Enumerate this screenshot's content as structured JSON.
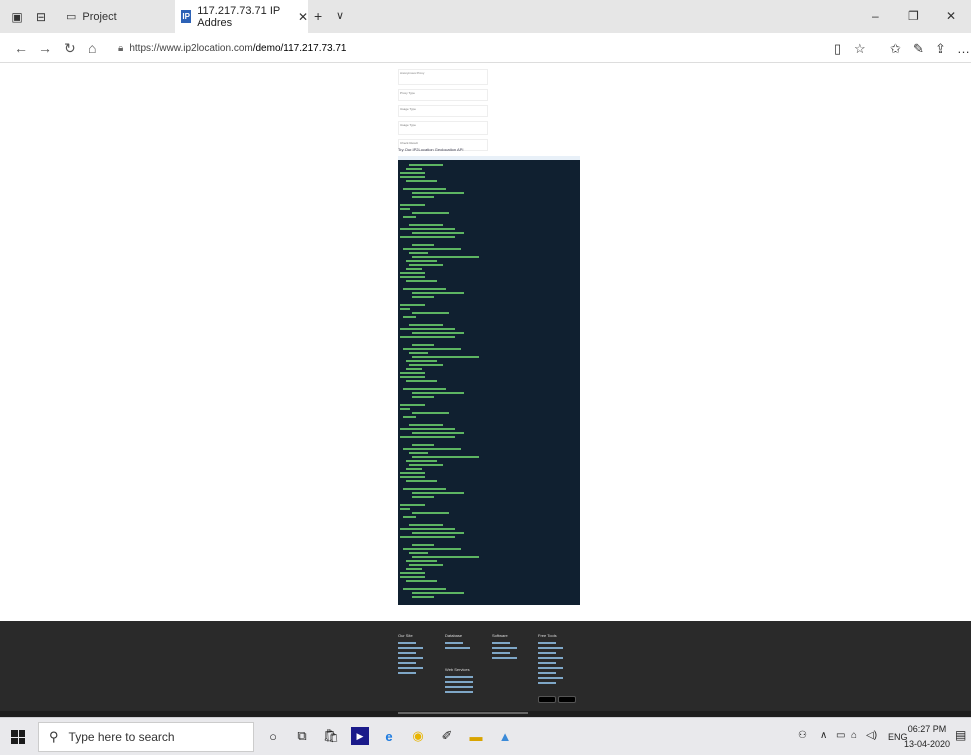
{
  "browser": {
    "tab_project": "Project",
    "active_tab_title": "117.217.73.71 IP Addres",
    "favicon_text": "IP",
    "new_tab": "+",
    "tab_menu": "∨",
    "url_host": "https://www.ip2location.com",
    "url_path": "/demo/117.217.73.71",
    "win_min": "–",
    "win_max": "❐",
    "win_close": "✕"
  },
  "page": {
    "try_label": "Try Our IP2Location Geolocation API",
    "form_rows": [
      "Anonymous Proxy",
      "Proxy Type",
      "Usage Type",
      "Usage Type",
      "Check Result"
    ]
  },
  "footer": {
    "columns": [
      {
        "head": "Our Site",
        "links": 7
      },
      {
        "head": "Database",
        "links": 2
      },
      {
        "head": "Software",
        "links": 4
      },
      {
        "head": "Free Tools",
        "links": 9
      }
    ],
    "sub_head": "Web Services"
  },
  "taskbar": {
    "search_placeholder": "Type here to search",
    "lang": "ENG",
    "time": "06:27 PM",
    "date": "13-04-2020"
  }
}
